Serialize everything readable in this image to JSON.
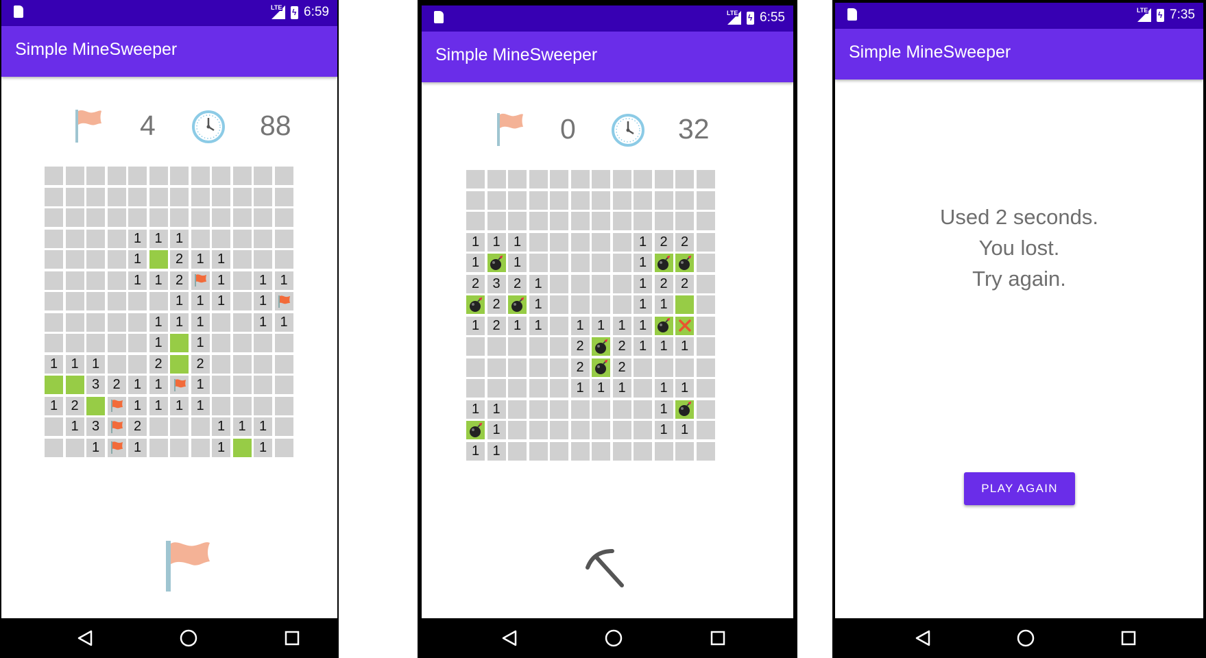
{
  "screens": [
    {
      "status_time": "6:59",
      "app_title": "Simple MineSweeper",
      "flags_left": "4",
      "time_elapsed": "88",
      "mode_icon": "flag-icon",
      "board": [
        "............",
        "............",
        "............",
        "....111.....",
        "....1G211...",
        "....112F1.11",
        "......111.1F",
        ".....111..11",
        ".....1G1....",
        "111..2G2....",
        "GG3211F1....",
        "12GF1111....",
        ".13F2...111.",
        "..1F1...1G1."
      ]
    },
    {
      "status_time": "6:55",
      "app_title": "Simple MineSweeper",
      "flags_left": "0",
      "time_elapsed": "32",
      "mode_icon": "pickaxe-icon",
      "board": [
        "............",
        "............",
        "............",
        "111     122",
        "1B1     1BB",
        "2321    122",
        "B2B1    11G",
        "1211 1111BX",
        "     2B2111",
        "     2B2   ",
        "     111 11",
        "11       1B",
        "B1       11",
        "11         "
      ]
    },
    {
      "status_time": "7:35",
      "app_title": "Simple MineSweeper",
      "message_lines": [
        "Used 2 seconds.",
        "You lost.",
        "Try again."
      ],
      "button_label": "PLAY AGAIN"
    }
  ],
  "colors": {
    "status_bar": "#3700b3",
    "app_bar": "#6a2de9",
    "cell_hidden": "#d0d0d0",
    "cell_green": "#97cc46",
    "flag_small": "#f26b3a",
    "flag_big": "#f4b296"
  }
}
